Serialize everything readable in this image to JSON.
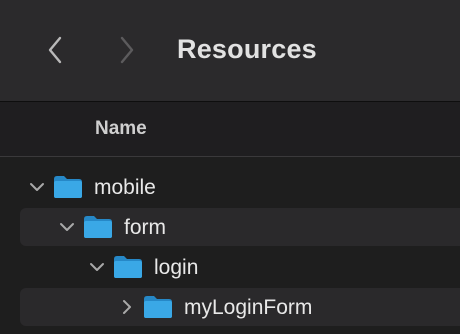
{
  "window": {
    "title": "Resources"
  },
  "toolbar": {
    "back_icon": "chevron-left-icon",
    "forward_icon": "chevron-right-icon"
  },
  "list": {
    "column_header": "Name",
    "items": [
      {
        "label": "mobile",
        "expanded": true,
        "icon": "folder-icon"
      },
      {
        "label": "form",
        "expanded": true,
        "icon": "folder-icon"
      },
      {
        "label": "login",
        "expanded": true,
        "icon": "folder-icon"
      },
      {
        "label": "myLoginForm",
        "expanded": false,
        "icon": "folder-icon"
      }
    ]
  },
  "colors": {
    "folder_blue": "#3aa8e6",
    "folder_blue_dark": "#2688c7",
    "toolbar_bg": "#2b2a2c",
    "window_bg": "#1e1e1e",
    "alt_row_bg": "#2a292b"
  }
}
